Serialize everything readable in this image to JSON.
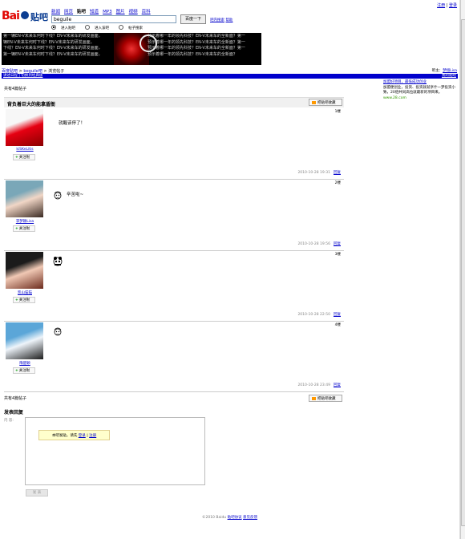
{
  "top_links": {
    "login": "登录",
    "register": "注册"
  },
  "nav": {
    "items": [
      "新闻",
      "网页",
      "贴吧",
      "知道",
      "MP3",
      "图片",
      "视频",
      "百科"
    ],
    "current_index": 2
  },
  "search": {
    "value": "beguile",
    "button": "百度一下",
    "links": [
      "吧内搜索",
      "帮助"
    ]
  },
  "radios": {
    "items": [
      "进入贴吧",
      "进入该吧",
      "帖子搜索"
    ],
    "selected_index": 0
  },
  "banner": {
    "left_text": "第一辆EN-V未来车何时下线？EN-V未来车的研发画面，\n辆EN-V未来车何时下线？EN-V未来车的研发画面，\n下线？EN-V未来车何时下线？EN-V未来车的研发画面，\n第一辆EN-V未来车何时下线？EN-V未来车的研发画面，",
    "right_text": "预示着哪一年的领先科技？EN-V未来车的全新面？第一\n预示着哪一年的领先科技？EN-V未来车的全新面？第一\n预示着哪一年的领先科技？EN-V未来车的全新面？第一\n预示着哪一年的领先科技？EN-V未来车的全新面？"
  },
  "breadcrumb": {
    "home": "百度贴吧",
    "bar": "beguile吧",
    "page": "浏览帖子",
    "sep": " > "
  },
  "crumb_right": {
    "label": "吧主：",
    "value": "梦栩Lisa"
  },
  "bluebar": {
    "left": "讲述日程",
    "left2": "切换到经典版",
    "right": "我的贴吧"
  },
  "thread": {
    "count_label": "共有4篇帖子",
    "title": "背负着巨大的能拿盾衙",
    "collect": "把贴吧收藏"
  },
  "posts": [
    {
      "floor": "1楼",
      "user": "kiSKeLitis",
      "follow": "关注啦",
      "content": "就醒该停了！",
      "time": "2010-10-28 19:31",
      "reply": "回复",
      "avatar_colors": [
        "#f7f7f7",
        "#e60012",
        "#8b0000"
      ]
    },
    {
      "floor": "2楼",
      "user": "李梦颖Lisa",
      "follow": "关注啦",
      "content": "辛苦啦~",
      "time": "2010-10-28 19:56",
      "reply": "回复",
      "avatar_colors": [
        "#7aa7b8",
        "#f1d6c6",
        "#3a2a22"
      ]
    },
    {
      "floor": "3楼",
      "user": "凯山猫猫",
      "follow": "关注啦",
      "content": "",
      "time": "2010-10-28 22:50",
      "reply": "回复",
      "avatar_colors": [
        "#1b1b1b",
        "#f0c8b4",
        "#6b2a1c"
      ]
    },
    {
      "floor": "4楼",
      "user": "隋楚颖",
      "follow": "关注啦",
      "content": "",
      "time": "2010-10-28 23:49",
      "reply": "回复",
      "avatar_colors": [
        "#5ba6d8",
        "#eef4fa",
        "#1c1c1c"
      ]
    }
  ],
  "side": {
    "ad_title": "加盟好项目，最低成功创业",
    "ad_text": "加盟便创业，投资、投资就就享什一梦投资小致，20倍共同高拉就最新的项目来。",
    "ad_url": "www.28.com"
  },
  "bottom": {
    "count_label": "共有4篇帖子",
    "collect": "把贴吧收藏",
    "reply_title": "发表回复",
    "content_label": "内  容:",
    "login_tip": "本吧发贴，请先",
    "login_link": "登录",
    "sep": "|",
    "register_link": "注册",
    "submit": "发  表"
  },
  "footer": {
    "copyright": "©2010 Baidu",
    "links": [
      "贴吧协议",
      "意见反馈"
    ]
  }
}
